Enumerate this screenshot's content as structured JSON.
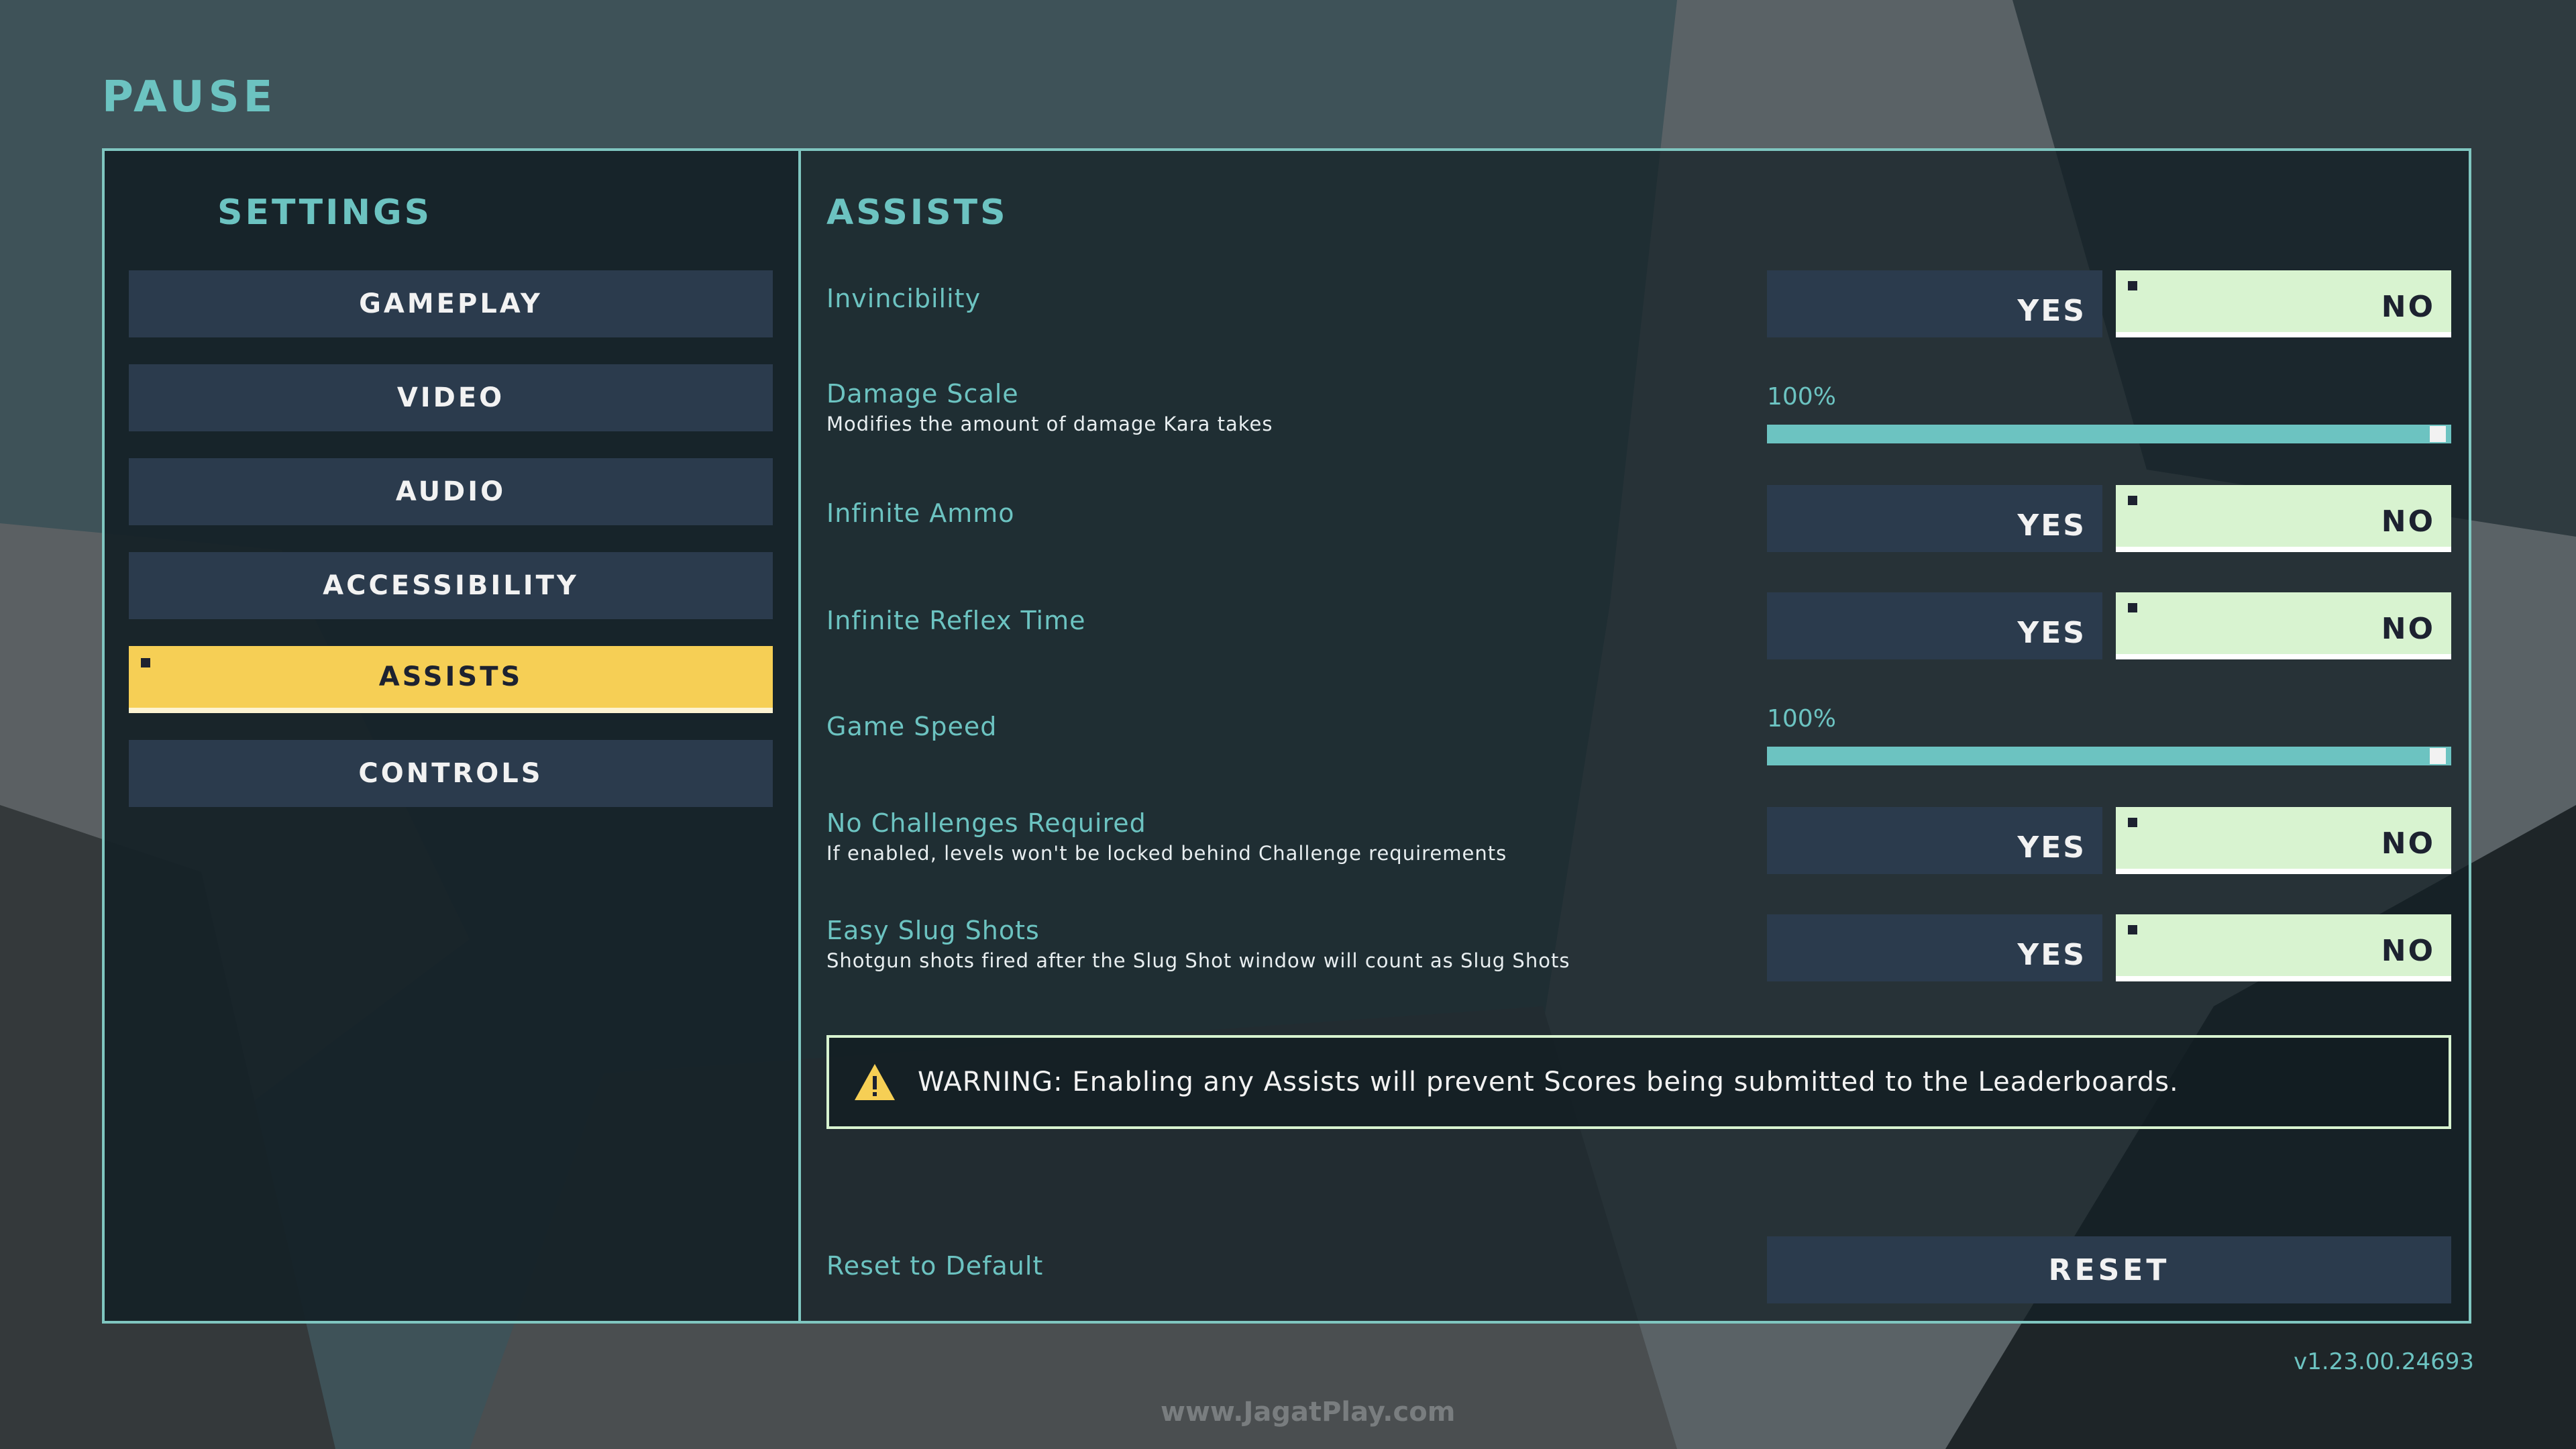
{
  "header": {
    "title": "PAUSE"
  },
  "sidebar": {
    "title": "SETTINGS",
    "items": [
      {
        "label": "GAMEPLAY",
        "active": false
      },
      {
        "label": "VIDEO",
        "active": false
      },
      {
        "label": "AUDIO",
        "active": false
      },
      {
        "label": "ACCESSIBILITY",
        "active": false
      },
      {
        "label": "ASSISTS",
        "active": true
      },
      {
        "label": "CONTROLS",
        "active": false
      }
    ]
  },
  "main": {
    "title": "ASSISTS",
    "options": [
      {
        "label": "Invincibility",
        "yes_label": "YES",
        "no_label": "NO",
        "selected": "NO"
      },
      {
        "label": "Damage Scale",
        "description": "Modifies the amount of damage Kara takes",
        "value_label": "100%",
        "value": 100
      },
      {
        "label": "Infinite Ammo",
        "yes_label": "YES",
        "no_label": "NO",
        "selected": "NO"
      },
      {
        "label": "Infinite Reflex Time",
        "yes_label": "YES",
        "no_label": "NO",
        "selected": "NO"
      },
      {
        "label": "Game Speed",
        "value_label": "100%",
        "value": 100
      },
      {
        "label": "No Challenges Required",
        "description": "If enabled, levels won't be locked behind Challenge requirements",
        "yes_label": "YES",
        "no_label": "NO",
        "selected": "NO"
      },
      {
        "label": "Easy Slug Shots",
        "description": "Shotgun shots fired after the Slug Shot window will count as Slug Shots",
        "yes_label": "YES",
        "no_label": "NO",
        "selected": "NO"
      }
    ],
    "warning": {
      "icon": "warning-triangle-icon",
      "text": "WARNING: Enabling any Assists will prevent Scores being submitted to the Leaderboards."
    },
    "reset": {
      "label": "Reset to Default",
      "button_label": "RESET"
    }
  },
  "footer": {
    "version": "v1.23.00.24693",
    "watermark": "www.JagatPlay.com"
  },
  "colors": {
    "accent": "#6cc3c1",
    "active": "#f6cf55",
    "button": "#2b3b4d",
    "selected": "#d8f3d0"
  }
}
